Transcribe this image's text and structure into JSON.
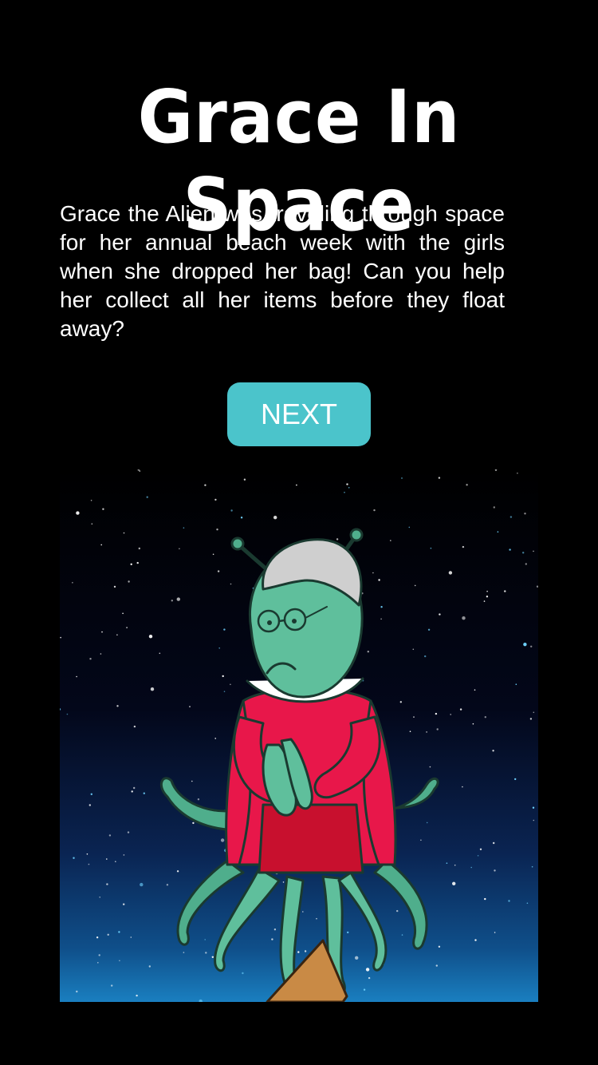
{
  "header": {
    "title": "Grace In Space"
  },
  "intro": {
    "text": "Grace the Alien was traveling through space for her annual beach week with the girls when she dropped her bag! Can you help her collect all her items before they float away?"
  },
  "actions": {
    "next_label": "NEXT"
  },
  "colors": {
    "background": "#000000",
    "accent_button": "#4bc4cb",
    "alien_skin": "#5fbf9c",
    "cardigan": "#e8174a",
    "dress": "#c8102e",
    "hair": "#cfcfcf",
    "bag": "#c98a45"
  },
  "scene": {
    "character": "grace-alien",
    "icons": [
      "star-field",
      "alien-character",
      "floating-bag"
    ]
  }
}
